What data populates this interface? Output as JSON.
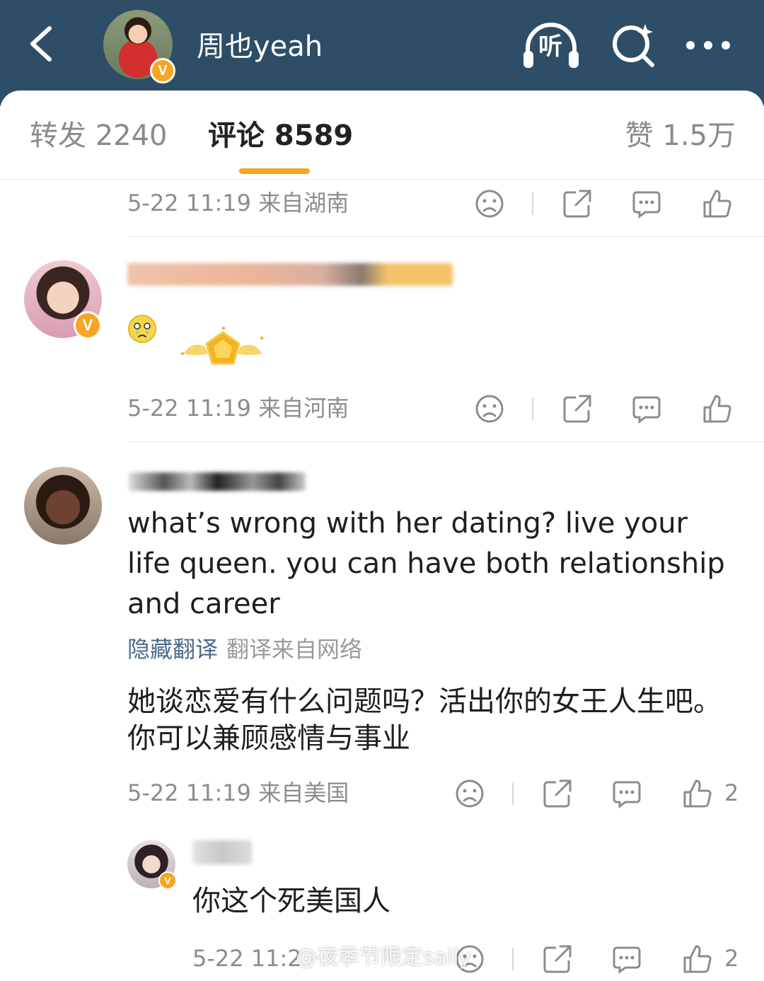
{
  "header": {
    "title": "周也yeah",
    "listen_label": "听",
    "verified_mark": "V",
    "background_color": "#2e4d66",
    "icons": [
      "back-icon",
      "listen-icon",
      "search-icon",
      "more-icon"
    ]
  },
  "tabs": {
    "repost": "转发 2240",
    "comment": "评论 8589",
    "like": "赞 1.5万",
    "active_color": "#f5a623"
  },
  "comments": [
    {
      "time_location": "5-22 11:19  来自湖南",
      "like_count": ""
    },
    {
      "time_location": "5-22 11:19  来自河南",
      "emoji": "crying-emoji",
      "like_count": ""
    },
    {
      "text_en": "what’s wrong with her dating? live your life queen. you can have both relationship and career",
      "translation_hide": "隐藏翻译",
      "translation_source": "翻译来自网络",
      "text_zh": "她谈恋爱有什么问题吗？活出你的女王人生吧。你可以兼顾感情与事业",
      "time_location": "5-22 11:19  来自美国",
      "like_count": "2"
    },
    {
      "text": "你这个死美国人",
      "time_location": "5-22 11:2",
      "like_count": "2"
    }
  ],
  "watermark": "@夜季节限定sally"
}
